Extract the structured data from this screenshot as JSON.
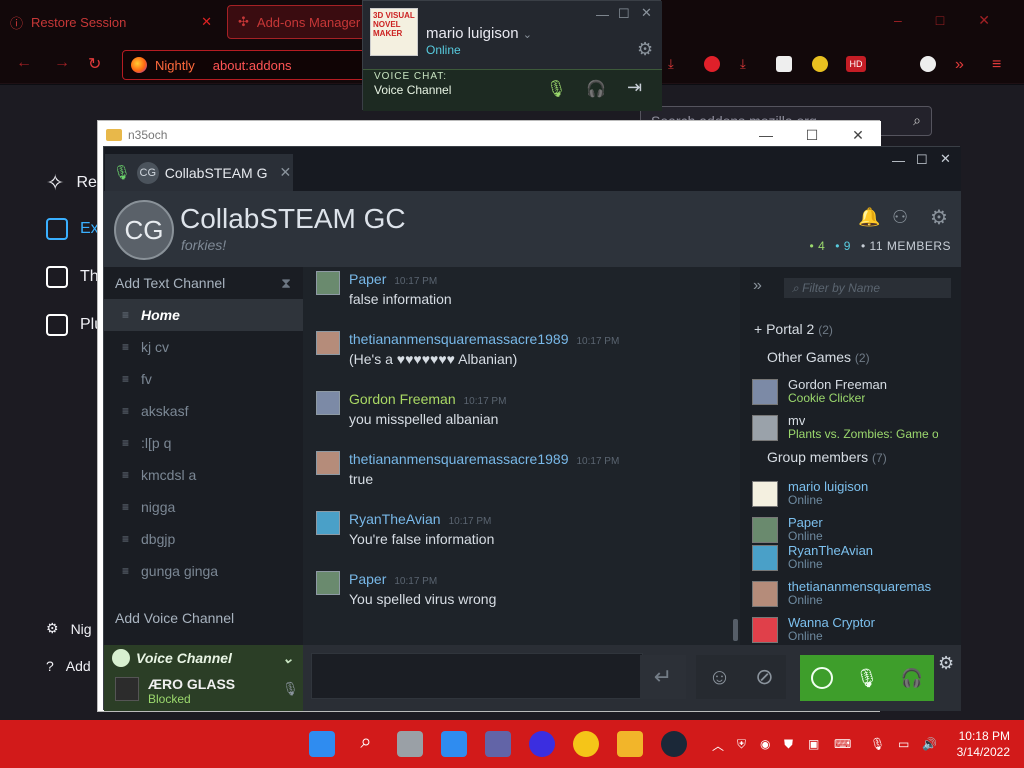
{
  "browser": {
    "tabs": [
      {
        "label": "Restore Session"
      },
      {
        "label": "Add-ons Manager"
      }
    ],
    "url_brand": "Nightly",
    "url": "about:addons",
    "search_placeholder": "Search addons.mozilla.org",
    "sidebar": {
      "items": [
        "Re",
        "Ext",
        "The",
        "Plu"
      ],
      "bottom": [
        "Nig",
        "Add"
      ]
    }
  },
  "explorer": {
    "title": "n35och"
  },
  "friends_popup": {
    "username": "mario luigison",
    "status": "Online",
    "avatar_text": "3D VISUAL NOVEL MAKER",
    "voice_label": "VOICE CHAT:",
    "voice_channel": "Voice Channel"
  },
  "chat": {
    "tab_label": "CollabSTEAM G",
    "avatar_initials": "CG",
    "group_name": "CollabSTEAM GC",
    "tagline": "forkies!",
    "counts": {
      "in_game": "4",
      "online": "9",
      "members": "11 MEMBERS"
    },
    "channels": {
      "add_text": "Add Text Channel",
      "list": [
        "Home",
        "kj cv",
        "fv",
        "akskasf",
        ":l[p q",
        "kmcdsl a",
        "nigga",
        "dbgjp",
        "gunga ginga"
      ],
      "add_voice": "Add Voice Channel"
    },
    "voice_panel": {
      "channel": "Voice Channel",
      "user": "ÆRO GLASS",
      "user_status": "Blocked"
    },
    "messages": [
      {
        "name": "Paper",
        "time": "10:17 PM",
        "text": "false information",
        "in_game": false
      },
      {
        "name": "thetiananmensquaremassacre1989",
        "time": "10:17 PM",
        "text": "(He's a ♥♥♥♥♥♥♥ Albanian)",
        "in_game": false
      },
      {
        "name": "Gordon Freeman",
        "time": "10:17 PM",
        "text": "you misspelled albanian",
        "in_game": true
      },
      {
        "name": "thetiananmensquaremassacre1989",
        "time": "10:17 PM",
        "text": "true",
        "in_game": false
      },
      {
        "name": "RyanTheAvian",
        "time": "10:17 PM",
        "text": "You're false information",
        "in_game": false
      },
      {
        "name": "Paper",
        "time": "10:17 PM",
        "text": "You spelled virus wrong",
        "in_game": false
      }
    ],
    "members_panel": {
      "filter_placeholder": "Filter by Name",
      "portal_group": {
        "label": "Portal 2",
        "count": "(2)"
      },
      "other_group": {
        "label": "Other Games",
        "count": "(2)"
      },
      "in_game": [
        {
          "name": "Gordon Freeman",
          "status": "Cookie Clicker"
        },
        {
          "name": "mv",
          "status": "Plants vs. Zombies: Game of"
        }
      ],
      "group_members": {
        "label": "Group members",
        "count": "(7)"
      },
      "online": [
        {
          "name": "mario luigison",
          "status": "Online"
        },
        {
          "name": "Paper",
          "status": "Online"
        },
        {
          "name": "RyanTheAvian",
          "status": "Online"
        },
        {
          "name": "thetiananmensquaremas",
          "status": "Online"
        },
        {
          "name": "Wanna Cryptor",
          "status": "Online"
        }
      ]
    }
  },
  "taskbar": {
    "time": "10:18 PM",
    "date": "3/14/2022"
  },
  "colors": {
    "browser_accent": "#c63737",
    "taskbar": "#d21a1a",
    "steam_online": "#57cbde",
    "steam_ingame": "#9bd86d",
    "voice_active": "#3e9e2b"
  }
}
